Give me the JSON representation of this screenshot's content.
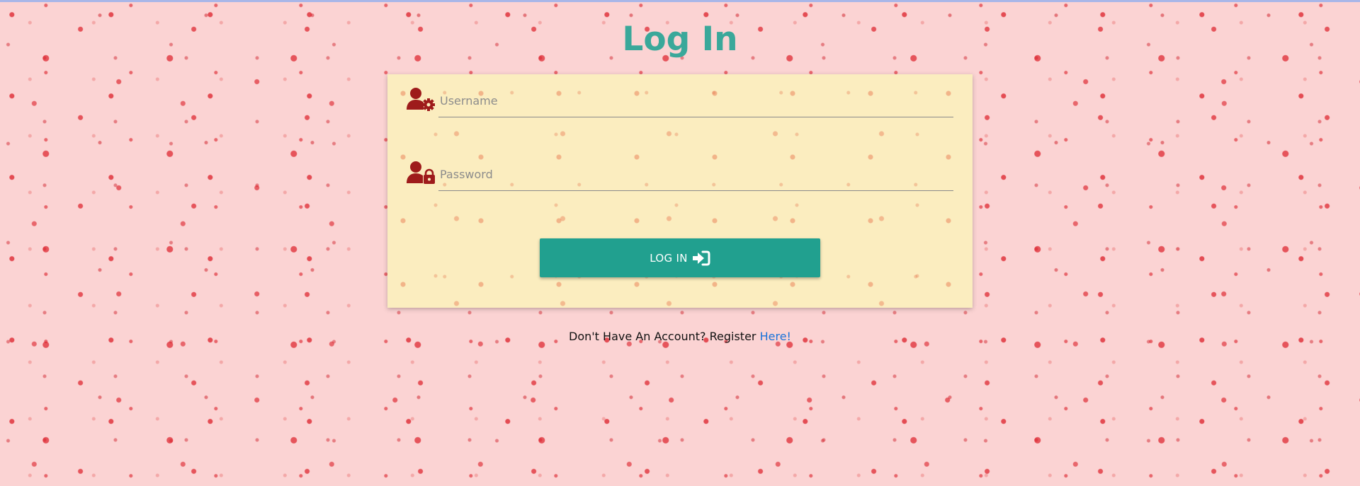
{
  "page": {
    "title": "Log In"
  },
  "form": {
    "username": {
      "placeholder": "Username",
      "value": ""
    },
    "password": {
      "placeholder": "Password",
      "value": ""
    },
    "submit_label": "LOG IN"
  },
  "footer": {
    "register_prompt": "Don't Have An Account? Register",
    "register_link_text": "Here!"
  },
  "icons": {
    "username": "user-gear-icon",
    "password": "user-lock-icon",
    "submit": "sign-in-icon"
  },
  "colors": {
    "title": "#3aa89a",
    "icon": "#9e1b1b",
    "button": "#21a08f",
    "link": "#1a73d9",
    "card": "#fbedbf",
    "background": "#fbd3d3"
  }
}
